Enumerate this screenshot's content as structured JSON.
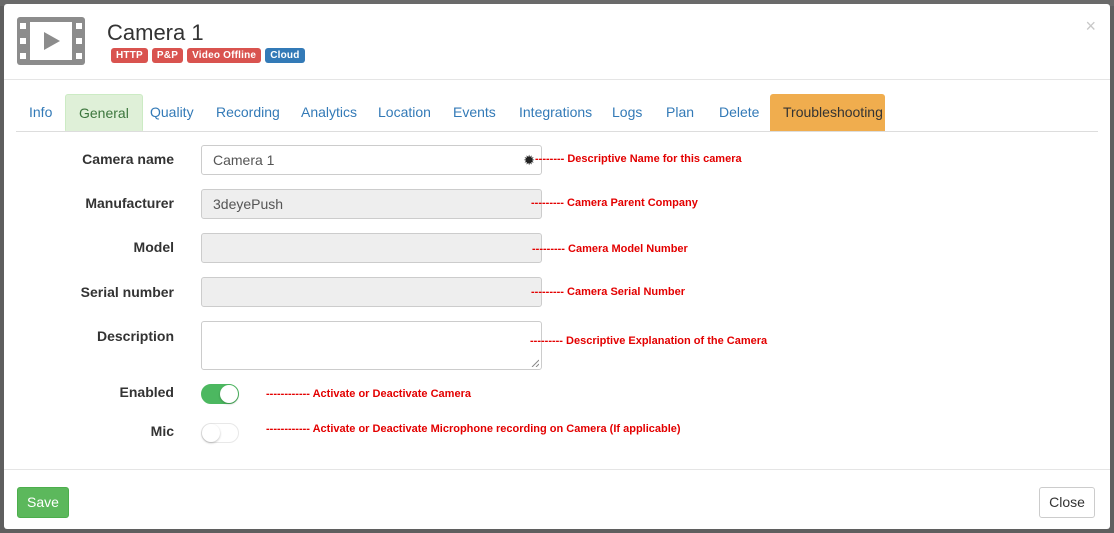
{
  "header": {
    "title": "Camera 1",
    "badges": [
      {
        "label": "HTTP",
        "color": "#d9534f"
      },
      {
        "label": "P&P",
        "color": "#d9534f"
      },
      {
        "label": "Video Offline",
        "color": "#d9534f"
      },
      {
        "label": "Cloud",
        "color": "#337ab7"
      }
    ],
    "close_label": "×",
    "icon": "video-file-icon"
  },
  "tabs": [
    {
      "label": "Info",
      "state": "normal"
    },
    {
      "label": "General",
      "state": "active"
    },
    {
      "label": "Quality",
      "state": "normal"
    },
    {
      "label": "Recording",
      "state": "normal"
    },
    {
      "label": "Analytics",
      "state": "normal"
    },
    {
      "label": "Location",
      "state": "normal"
    },
    {
      "label": "Events",
      "state": "normal"
    },
    {
      "label": "Integrations",
      "state": "normal"
    },
    {
      "label": "Logs",
      "state": "normal"
    },
    {
      "label": "Plan",
      "state": "normal"
    },
    {
      "label": "Delete",
      "state": "normal"
    },
    {
      "label": "Troubleshooting",
      "state": "warning"
    }
  ],
  "form": {
    "camera_name": {
      "label": "Camera name",
      "value": "Camera 1",
      "annotation": "-------- Descriptive Name for this camera",
      "icon": "gear-icon"
    },
    "manufacturer": {
      "label": "Manufacturer",
      "value": "3deyePush",
      "annotation": "--------- Camera Parent Company"
    },
    "model": {
      "label": "Model",
      "value": "",
      "annotation": "--------- Camera Model Number"
    },
    "serial_number": {
      "label": "Serial number",
      "value": "",
      "annotation": "--------- Camera Serial Number"
    },
    "description": {
      "label": "Description",
      "value": "",
      "annotation": "--------- Descriptive Explanation of the Camera"
    },
    "enabled": {
      "label": "Enabled",
      "on": true,
      "annotation": "------------ Activate or Deactivate Camera"
    },
    "mic": {
      "label": "Mic",
      "on": false,
      "annotation": "------------ Activate or Deactivate Microphone recording on Camera (If applicable)"
    }
  },
  "footer": {
    "save_label": "Save",
    "close_label": "Close"
  },
  "colors": {
    "active_tab_bg": "#dff0d8",
    "warning_tab_bg": "#f0ad4e",
    "toggle_on": "#4cb860",
    "annotation": "#e30000",
    "link": "#337ab7"
  }
}
